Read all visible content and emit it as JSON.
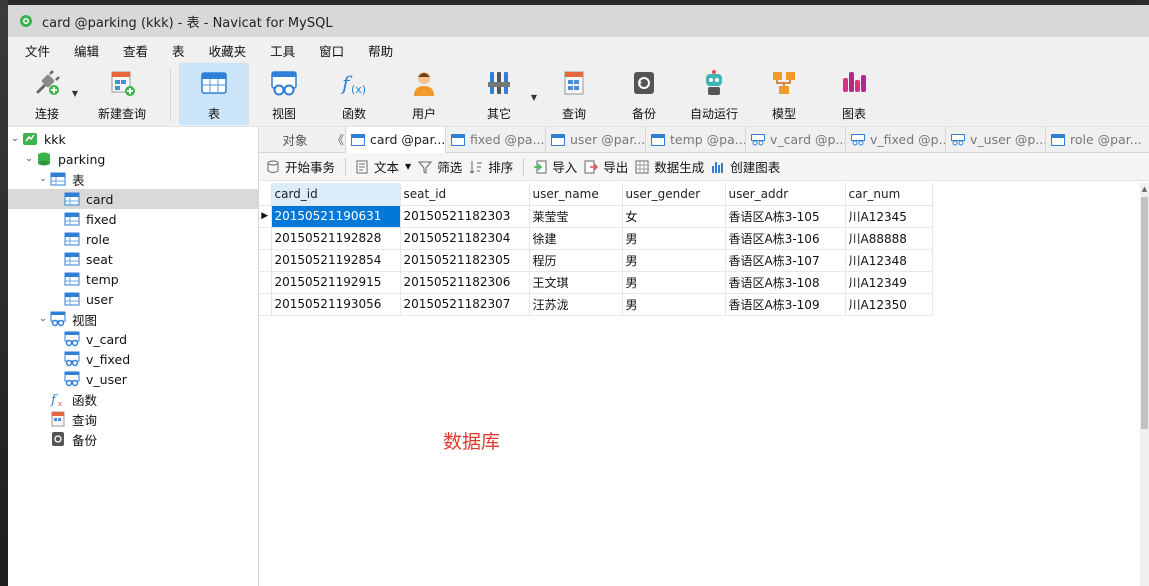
{
  "window": {
    "title": "card @parking (kkk) - 表 - Navicat for MySQL"
  },
  "menu": [
    "文件",
    "编辑",
    "查看",
    "表",
    "收藏夹",
    "工具",
    "窗口",
    "帮助"
  ],
  "toolbar": {
    "connect": "连接",
    "new_query": "新建查询",
    "table": "表",
    "view": "视图",
    "function": "函数",
    "user": "用户",
    "other": "其它",
    "query": "查询",
    "backup": "备份",
    "auto_run": "自动运行",
    "model": "模型",
    "chart": "图表"
  },
  "sidebar": {
    "connection": "kkk",
    "database": "parking",
    "tables_label": "表",
    "tables": [
      "card",
      "fixed",
      "role",
      "seat",
      "temp",
      "user"
    ],
    "views_label": "视图",
    "views": [
      "v_card",
      "v_fixed",
      "v_user"
    ],
    "functions_label": "函数",
    "queries_label": "查询",
    "backups_label": "备份"
  },
  "tabs": {
    "objects": "对象",
    "items": [
      "card @par...",
      "fixed @pa...",
      "user @par...",
      "temp @pa...",
      "v_card @p...",
      "v_fixed @p...",
      "v_user @p...",
      "role @par..."
    ]
  },
  "subtoolbar": {
    "begin_transaction": "开始事务",
    "text": "文本",
    "filter": "筛选",
    "sort": "排序",
    "import": "导入",
    "export": "导出",
    "data_generation": "数据生成",
    "create_chart": "创建图表"
  },
  "grid": {
    "columns": [
      "card_id",
      "seat_id",
      "user_name",
      "user_gender",
      "user_addr",
      "car_num"
    ],
    "rows": [
      [
        "20150521190631",
        "20150521182303",
        "莱莹莹",
        "女",
        "香语区A栋3-105",
        "川A12345"
      ],
      [
        "20150521192828",
        "20150521182304",
        "徐建",
        "男",
        "香语区A栋3-106",
        "川A88888"
      ],
      [
        "20150521192854",
        "20150521182305",
        "程历",
        "男",
        "香语区A栋3-107",
        "川A12348"
      ],
      [
        "20150521192915",
        "20150521182306",
        "王文琪",
        "男",
        "香语区A栋3-108",
        "川A12349"
      ],
      [
        "20150521193056",
        "20150521182307",
        "汪苏泷",
        "男",
        "香语区A栋3-109",
        "川A12350"
      ]
    ]
  },
  "annotation": "数据库",
  "colors": {
    "accent": "#0078d7",
    "annotation": "#e03b2f",
    "toolbar_active": "#cce4f7"
  }
}
